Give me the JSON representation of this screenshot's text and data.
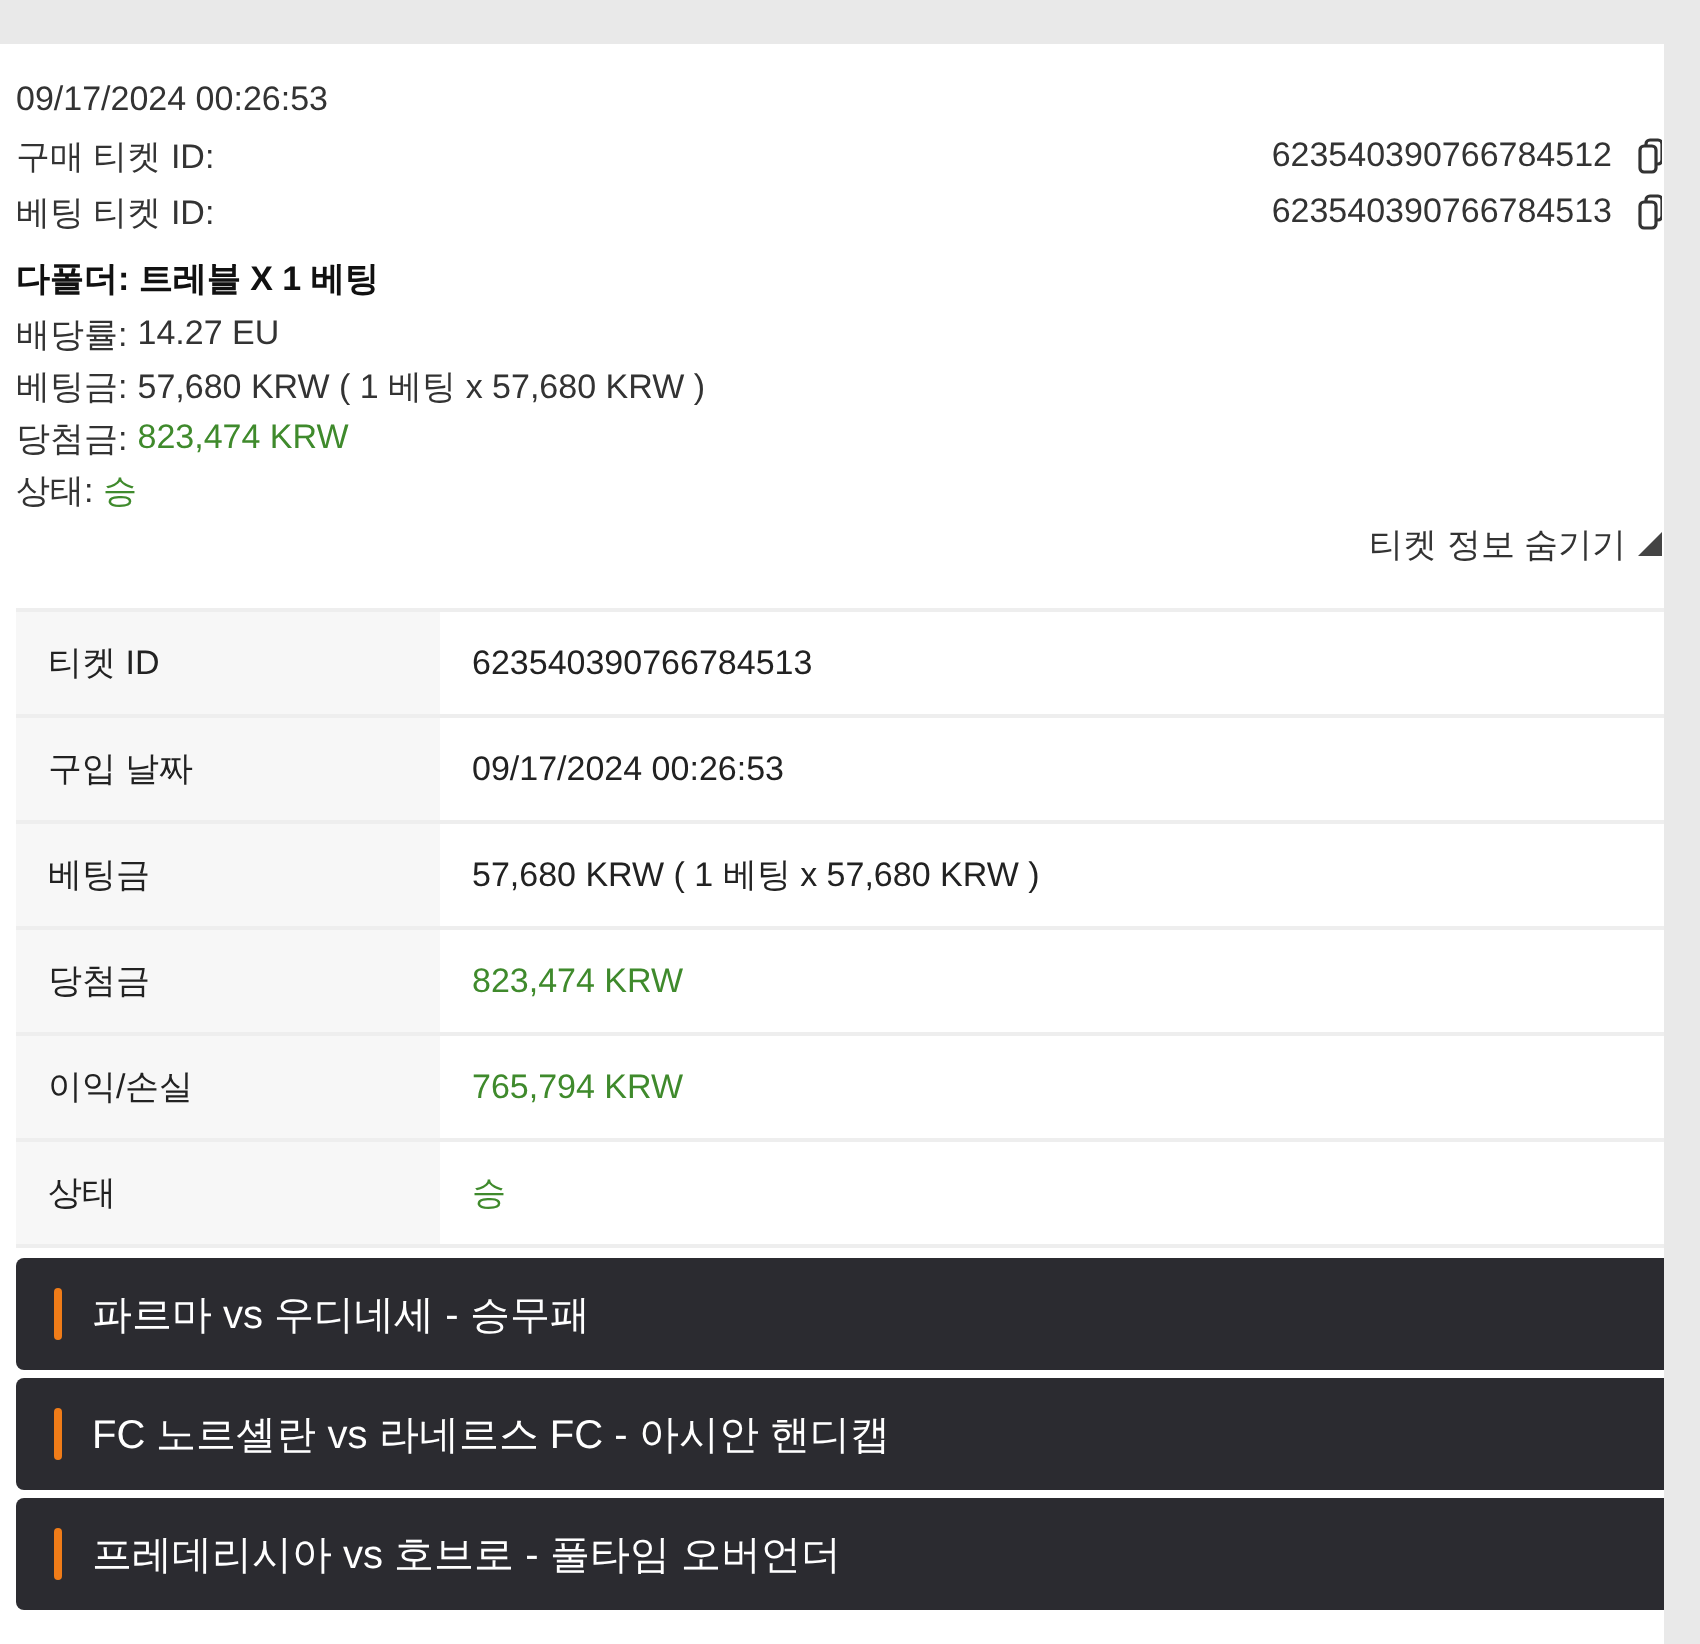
{
  "ticket": {
    "datetime": "09/17/2024 00:26:53",
    "ids": [
      {
        "label": "구매 티켓 ID:",
        "value": "623540390766784512"
      },
      {
        "label": "베팅 티켓 ID:",
        "value": "623540390766784513"
      }
    ],
    "title": "다폴더: 트레블 X 1 베팅",
    "fields": [
      {
        "label": "배당률:",
        "value": "14.27 EU",
        "positive": false
      },
      {
        "label": "베팅금:",
        "value": "57,680 KRW ( 1 베팅 x 57,680 KRW )",
        "positive": false
      },
      {
        "label": "당첨금:",
        "value": "823,474 KRW",
        "positive": true
      },
      {
        "label": "상태:",
        "value": "승",
        "positive": true
      }
    ]
  },
  "toggle": {
    "label": "티켓 정보 숨기기",
    "expanded": true
  },
  "table": {
    "rows": [
      {
        "label": "티켓 ID",
        "value": "623540390766784513",
        "positive": false
      },
      {
        "label": "구입 날짜",
        "value": "09/17/2024 00:26:53",
        "positive": false
      },
      {
        "label": "베팅금",
        "value": "57,680 KRW ( 1 베팅 x 57,680 KRW )",
        "positive": false
      },
      {
        "label": "당첨금",
        "value": "823,474 KRW",
        "positive": true
      },
      {
        "label": "이익/손실",
        "value": "765,794 KRW",
        "positive": true
      },
      {
        "label": "상태",
        "value": "승",
        "positive": true
      }
    ]
  },
  "events": [
    {
      "title": "파르마 vs 우디네세 - 승무패"
    },
    {
      "title": "FC 노르셸란 vs 라네르스 FC - 아시안 핸디캡"
    },
    {
      "title": "프레데리시아 vs 호브로 - 풀타임 오버언더"
    }
  ]
}
